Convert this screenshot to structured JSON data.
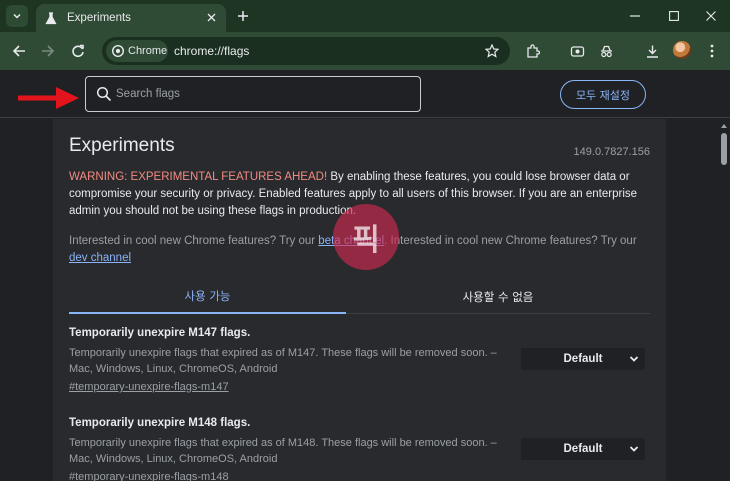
{
  "tab": {
    "title": "Experiments"
  },
  "omnibox": {
    "chip_label": "Chrome",
    "url": "chrome://flags"
  },
  "search": {
    "placeholder": "Search flags"
  },
  "reset_button": "모두 재설정",
  "page": {
    "title": "Experiments",
    "version": "149.0.7827.156",
    "warning_bold": "WARNING: EXPERIMENTAL FEATURES AHEAD!",
    "warning_text": " By enabling these features, you could lose browser data or compromise your security or privacy. Enabled features apply to all users of this browser. If you are an enterprise admin you should not be using these flags in production.",
    "interest_1": "Interested in cool new Chrome features? Try our ",
    "beta_link": "beta channel",
    "interest_2": ". Interested in cool new Chrome features? Try our ",
    "dev_link": "dev channel"
  },
  "tabs": {
    "available": "사용 가능",
    "unavailable": "사용할 수 없음"
  },
  "flags": [
    {
      "title": "Temporarily unexpire M147 flags.",
      "description": "Temporarily unexpire flags that expired as of M147. These flags will be removed soon. – Mac, Windows, Linux, ChromeOS, Android",
      "link": "#temporary-unexpire-flags-m147",
      "value": "Default"
    },
    {
      "title": "Temporarily unexpire M148 flags.",
      "description": "Temporarily unexpire flags that expired as of M148. These flags will be removed soon. – Mac, Windows, Linux, ChromeOS, Android",
      "link": "#temporary-unexpire-flags-m148",
      "value": "Default"
    }
  ],
  "watermark": "픽",
  "colors": {
    "tab_strip": "#1f3524",
    "toolbar": "#2f4a35",
    "accent": "#8ab4f8",
    "warning": "#f28b82",
    "annotation_arrow": "#e3141b"
  }
}
